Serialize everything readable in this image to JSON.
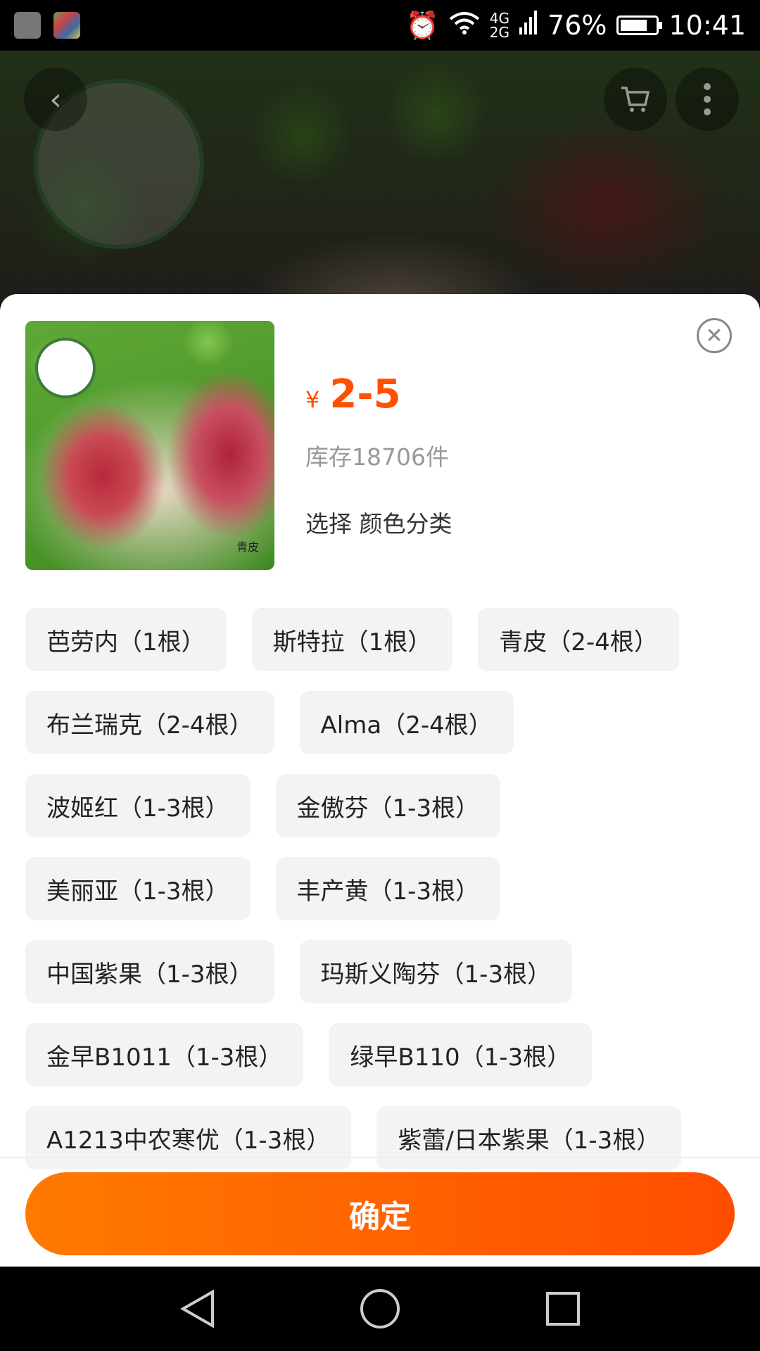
{
  "status_bar": {
    "network_top": "4G",
    "network_bottom": "2G",
    "battery_percent": "76%",
    "battery_level": 0.76,
    "time": "10:41"
  },
  "header": {
    "back_icon": "back-arrow-icon",
    "cart_icon": "cart-icon",
    "more_icon": "more-vertical-icon"
  },
  "product": {
    "thumb_caption": "青皮",
    "price_symbol": "¥",
    "price": "2-5",
    "stock": "库存18706件",
    "choose": "选择 颜色分类"
  },
  "options": [
    "芭劳内（1根）",
    "斯特拉（1根）",
    "青皮（2-4根）",
    "布兰瑞克（2-4根）",
    "Alma（2-4根）",
    "波姬红（1-3根）",
    "金傲芬（1-3根）",
    "美丽亚（1-3根）",
    "丰产黄（1-3根）",
    "中国紫果（1-3根）",
    "玛斯义陶芬（1-3根）",
    "金早B1011（1-3根）",
    "绿早B110（1-3根）",
    "A1213中农寒优（1-3根）",
    "紫蕾/日本紫果（1-3根）"
  ],
  "confirm_label": "确定",
  "colors": {
    "accent": "#ff5000",
    "button_start": "#ff7a00",
    "button_end": "#ff4d00"
  }
}
